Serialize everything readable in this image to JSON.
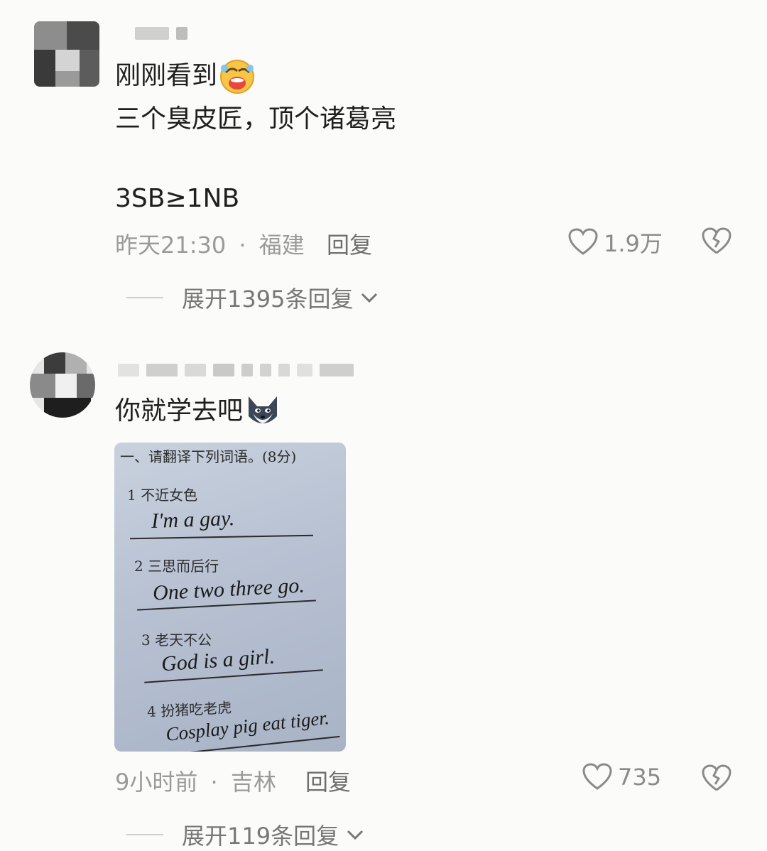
{
  "comments": [
    {
      "lines": [
        "刚刚看到",
        "三个臭皮匠，顶个诸葛亮",
        "3SB≥1NB"
      ],
      "emoji": "grimacing-laugh-emoji",
      "time": "昨天21:30",
      "location": "福建",
      "separator": "·",
      "reply_label": "回复",
      "likes": "1.9万",
      "expand_label": "展开1395条回复"
    },
    {
      "lines": [
        "你就学去吧"
      ],
      "emoji": "wolf-head-emoji",
      "image": {
        "title": "一、请翻译下列词语。(8分)",
        "items": [
          {
            "q": "1 不近女色",
            "a": "I'm a gay."
          },
          {
            "q": "2 三思而后行",
            "a": "One two three go."
          },
          {
            "q": "3 老天不公",
            "a": "God is a girl."
          },
          {
            "q": "4 扮猪吃老虎",
            "a": "Cosplay pig eat tiger."
          }
        ]
      },
      "time": "9小时前",
      "location": "吉林",
      "separator": "·",
      "reply_label": "回复",
      "likes": "735",
      "expand_label": "展开119条回复"
    }
  ],
  "colors": {
    "background": "#fbfbf9",
    "text": "#1f1f1f",
    "meta": "#9a9a9a",
    "icon": "#8a8a8a"
  }
}
